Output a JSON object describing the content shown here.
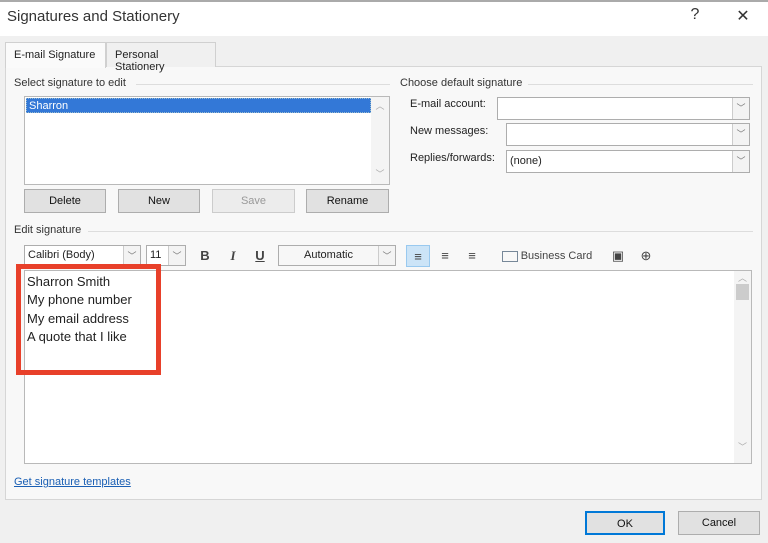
{
  "window": {
    "title": "Signatures and Stationery",
    "help": "?",
    "close": "✕"
  },
  "tabs": [
    {
      "label": "E-mail Signature"
    },
    {
      "label": "Personal Stationery"
    }
  ],
  "select_group": {
    "label": "Select signature to edit",
    "items": [
      "Sharron"
    ],
    "selected": "Sharron"
  },
  "buttons": {
    "delete": "Delete",
    "new": "New",
    "save": "Save",
    "rename": "Rename"
  },
  "default_group": {
    "label": "Choose default signature",
    "email_account_label": "E-mail account:",
    "email_account_value": "",
    "new_messages_label": "New messages:",
    "new_messages_value": "",
    "replies_label": "Replies/forwards:",
    "replies_value": "(none)"
  },
  "edit_group": {
    "label": "Edit signature"
  },
  "toolbar": {
    "font": "Calibri (Body)",
    "size": "11",
    "bold": "B",
    "italic": "I",
    "underline": "U",
    "color": "Automatic",
    "business_card": "Business Card"
  },
  "signature_lines": [
    "Sharron Smith",
    "My phone number",
    "My email address",
    "A quote that I like"
  ],
  "link": "Get signature templates",
  "footer": {
    "ok": "OK",
    "cancel": "Cancel"
  },
  "colors": {
    "selection": "#3378d7",
    "highlight_box": "#e8402a",
    "link": "#1a5fb4"
  }
}
